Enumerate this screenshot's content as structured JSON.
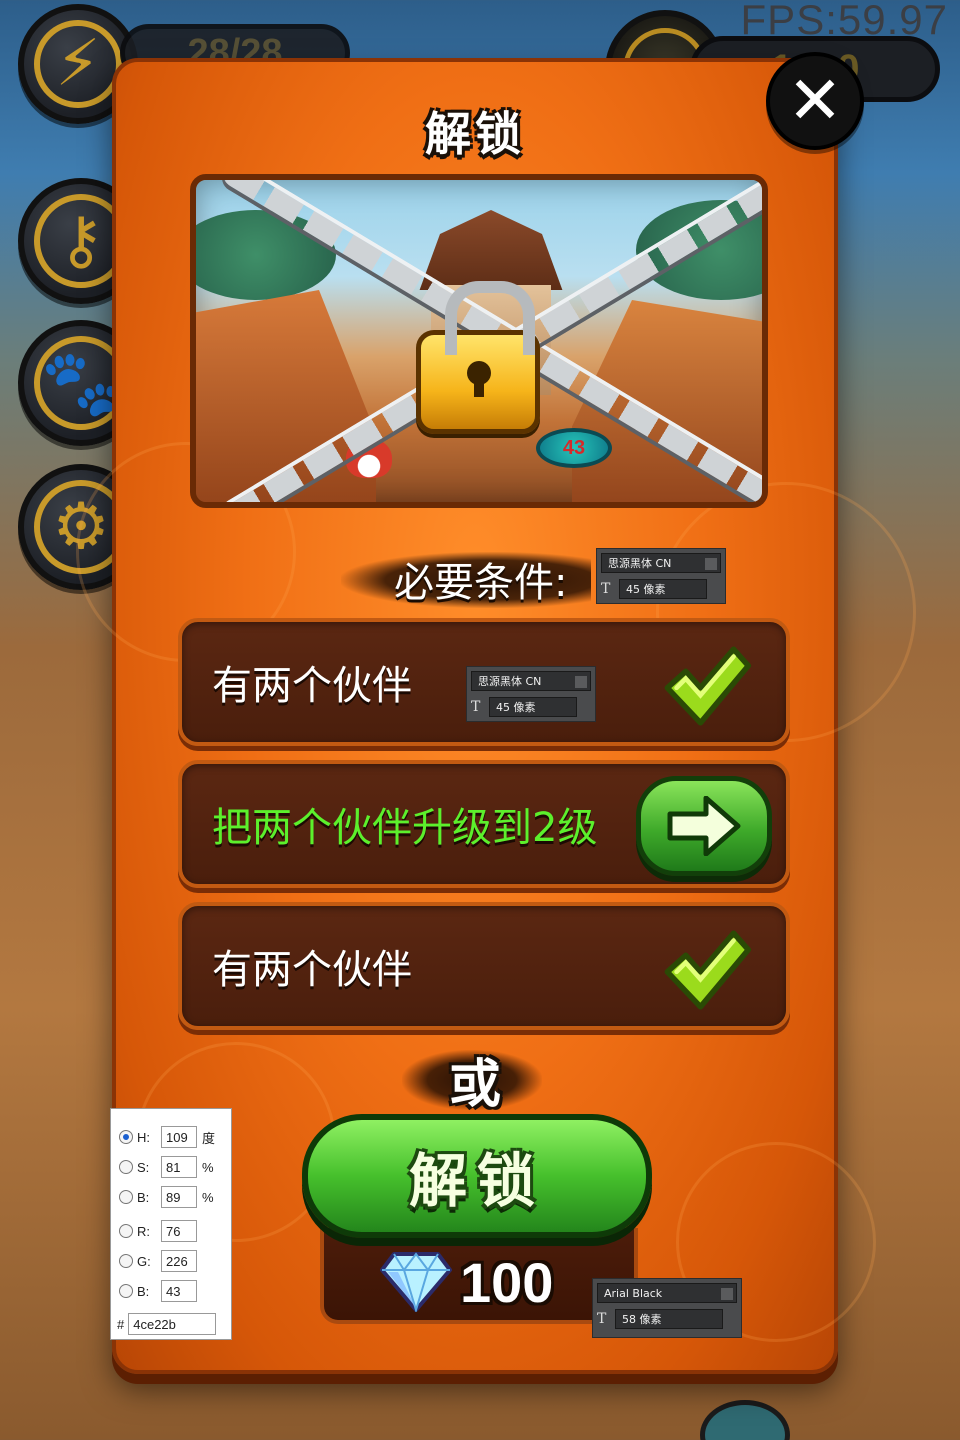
{
  "hud": {
    "fps_text": "FPS:59.97",
    "energy_text": "28/28",
    "coin_text": "1320",
    "side_icons": [
      "lightning-icon",
      "key-icon",
      "paw-icon",
      "gear-icon"
    ]
  },
  "dialog": {
    "title": "解锁",
    "close_glyph": "✕",
    "level_badge": "43",
    "requirements_label": "必要条件:",
    "requirements": [
      {
        "text": "有两个伙伴",
        "status": "done",
        "text_color": "#ffffff"
      },
      {
        "text": "把两个伙伴升级到2级",
        "status": "go",
        "text_color": "#4ce22b"
      },
      {
        "text": "有两个伙伴",
        "status": "done",
        "text_color": "#ffffff"
      }
    ],
    "or_label": "或",
    "unlock_button": "解锁",
    "price": "100",
    "price_currency_icon": "diamond-icon"
  },
  "font_tips": [
    {
      "font": "思源黑体 CN",
      "size": "45 像素"
    },
    {
      "font": "思源黑体 CN",
      "size": "45 像素"
    },
    {
      "font": "Arial Black",
      "size": "58 像素"
    }
  ],
  "color_picker": {
    "h_label": "H:",
    "h": "109",
    "h_unit": "度",
    "s_label": "S:",
    "s": "81",
    "s_unit": "%",
    "b_label": "B:",
    "b": "89",
    "b_unit": "%",
    "r_label": "R:",
    "r": "76",
    "g_label": "G:",
    "g": "226",
    "bl_label": "B:",
    "bl": "43",
    "hex_label": "#",
    "hex": "4ce22b"
  },
  "colors": {
    "panel_orange": "#f06f15",
    "accent_green": "#4ce22b",
    "row_brown": "#4a1e0c"
  }
}
